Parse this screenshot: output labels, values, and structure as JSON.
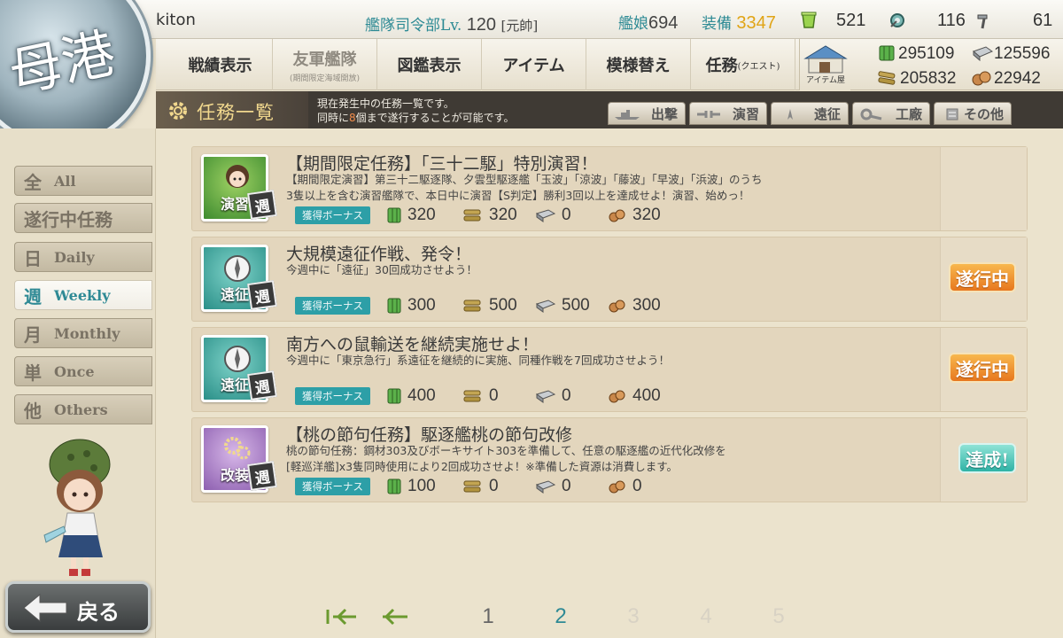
{
  "header": {
    "username": "kiton",
    "hq_label": "艦隊司令部",
    "lv_label": "Lv.",
    "level": "120",
    "rank": "[元帥]",
    "ships_label": "艦娘",
    "ships": "694",
    "equip_label": "装備",
    "equip": "3347",
    "bucket": "521",
    "devmat": "116",
    "screw": "61"
  },
  "port": {
    "label": "母港"
  },
  "nav": {
    "items": [
      {
        "label": "戦績表示",
        "sub": ""
      },
      {
        "label": "友軍艦隊",
        "sub": "(期間限定海域開放)"
      },
      {
        "label": "図鑑表示",
        "sub": ""
      },
      {
        "label": "アイテム",
        "sub": ""
      },
      {
        "label": "模様替え",
        "sub": ""
      },
      {
        "label": "任務",
        "tag": "(クエスト)"
      }
    ],
    "item_shop": "アイテム屋"
  },
  "resources": {
    "fuel": "295109",
    "ammo": "205832",
    "steel": "125596",
    "bauxite": "22942"
  },
  "quest_header": {
    "title": "任務一覧",
    "desc_line1": "現在発生中の任務一覧です。",
    "desc_line2_a": "同時に",
    "desc_line2_n": "8",
    "desc_line2_b": "個まで遂行することが可能です。",
    "tabs": [
      "出撃",
      "演習",
      "遠征",
      "工廠",
      "その他"
    ]
  },
  "filters": [
    {
      "big": "全",
      "label": "All",
      "active": false
    },
    {
      "big": "遂行中任務",
      "label": "",
      "active": false
    },
    {
      "big": "日",
      "label": "Daily",
      "active": false
    },
    {
      "big": "週",
      "label": "Weekly",
      "active": true
    },
    {
      "big": "月",
      "label": "Monthly",
      "active": false
    },
    {
      "big": "単",
      "label": "Once",
      "active": false
    },
    {
      "big": "他",
      "label": "Others",
      "active": false
    }
  ],
  "quests": [
    {
      "category": "演習",
      "badge": "週",
      "name": "【期間限定任務】「三十二駆」特別演習！",
      "detail1": "【期間限定演習】第三十二駆逐隊、夕雲型駆逐艦「玉波」「涼波」「藤波」「早波」「浜波」のうち",
      "detail2": "3隻以上を含む演習艦隊で、本日中に演習【S判定】勝利3回以上を達成せよ！演習、始めっ！",
      "bonus_label": "獲得ボーナス",
      "fuel": "320",
      "ammo": "320",
      "steel": "0",
      "bauxite": "320",
      "status": ""
    },
    {
      "category": "遠征",
      "badge": "週",
      "name": "大規模遠征作戦、発令！",
      "detail1": "今週中に「遠征」30回成功させよう！",
      "detail2": "",
      "bonus_label": "獲得ボーナス",
      "fuel": "300",
      "ammo": "500",
      "steel": "500",
      "bauxite": "300",
      "status": "遂行中"
    },
    {
      "category": "遠征",
      "badge": "週",
      "name": "南方への鼠輸送を継続実施せよ！",
      "detail1": "今週中に「東京急行」系遠征を継続的に実施、同種作戦を7回成功させよう！",
      "detail2": "",
      "bonus_label": "獲得ボーナス",
      "fuel": "400",
      "ammo": "0",
      "steel": "0",
      "bauxite": "400",
      "status": "遂行中"
    },
    {
      "category": "改装",
      "badge": "週",
      "name": "【桃の節句任務】駆逐艦桃の節句改修",
      "detail1": "桃の節句任務：鋼材303及びボーキサイト303を準備して、任意の駆逐艦の近代化改修を",
      "detail2": "[軽巡洋艦]x3隻同時使用により2回成功させよ！※準備した資源は消費します。",
      "bonus_label": "獲得ボーナス",
      "fuel": "100",
      "ammo": "0",
      "steel": "0",
      "bauxite": "0",
      "status": "達成!"
    }
  ],
  "pager": {
    "pages": [
      "1",
      "2",
      "3",
      "4",
      "5"
    ],
    "current": "2"
  },
  "back": {
    "label": "戻る"
  },
  "colors": {
    "accent": "#2d8a94",
    "equip": "#e0a416",
    "in_progress": "#e7771e",
    "complete": "#2fb3a6"
  }
}
